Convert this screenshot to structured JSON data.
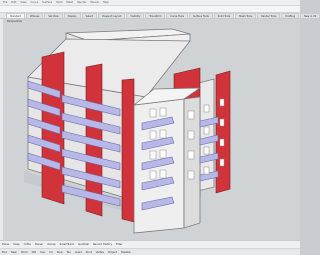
{
  "app": {
    "menu": [
      "File",
      "Edit",
      "View",
      "Curve",
      "Surface",
      "Solid",
      "Mesh",
      "Render",
      "Panels",
      "Help"
    ]
  },
  "tabs": [
    {
      "label": "Standard",
      "active": true
    },
    {
      "label": "CPlanes",
      "active": false
    },
    {
      "label": "Set View",
      "active": false
    },
    {
      "label": "Display",
      "active": false
    },
    {
      "label": "Select",
      "active": false
    },
    {
      "label": "Viewport Layout",
      "active": false
    },
    {
      "label": "Visibility",
      "active": false
    },
    {
      "label": "Transform",
      "active": false
    },
    {
      "label": "Curve Tools",
      "active": false
    },
    {
      "label": "Surface Tools",
      "active": false
    },
    {
      "label": "Solid Tools",
      "active": false
    },
    {
      "label": "Mesh Tools",
      "active": false
    },
    {
      "label": "Render Tools",
      "active": false
    },
    {
      "label": "Drafting",
      "active": false
    },
    {
      "label": "New in V6",
      "active": false
    }
  ],
  "viewport": {
    "label": "Perspective"
  },
  "status": {
    "row1": [
      "Plane",
      "Snap",
      "Ortho",
      "Planar",
      "Osnap",
      "SmartTrack",
      "Gumball",
      "Record History",
      "Filter"
    ],
    "row2": [
      "End",
      "Near",
      "Point",
      "Mid",
      "Cen",
      "Int",
      "Perp",
      "Tan",
      "Quad",
      "Knot",
      "Vertex",
      "Project",
      "Disable"
    ]
  },
  "colors": {
    "accent_red": "#d0343a",
    "balcony_glass": "#b7b8e8",
    "wall": "#e6e6e6",
    "background": "#d0d3d6"
  }
}
